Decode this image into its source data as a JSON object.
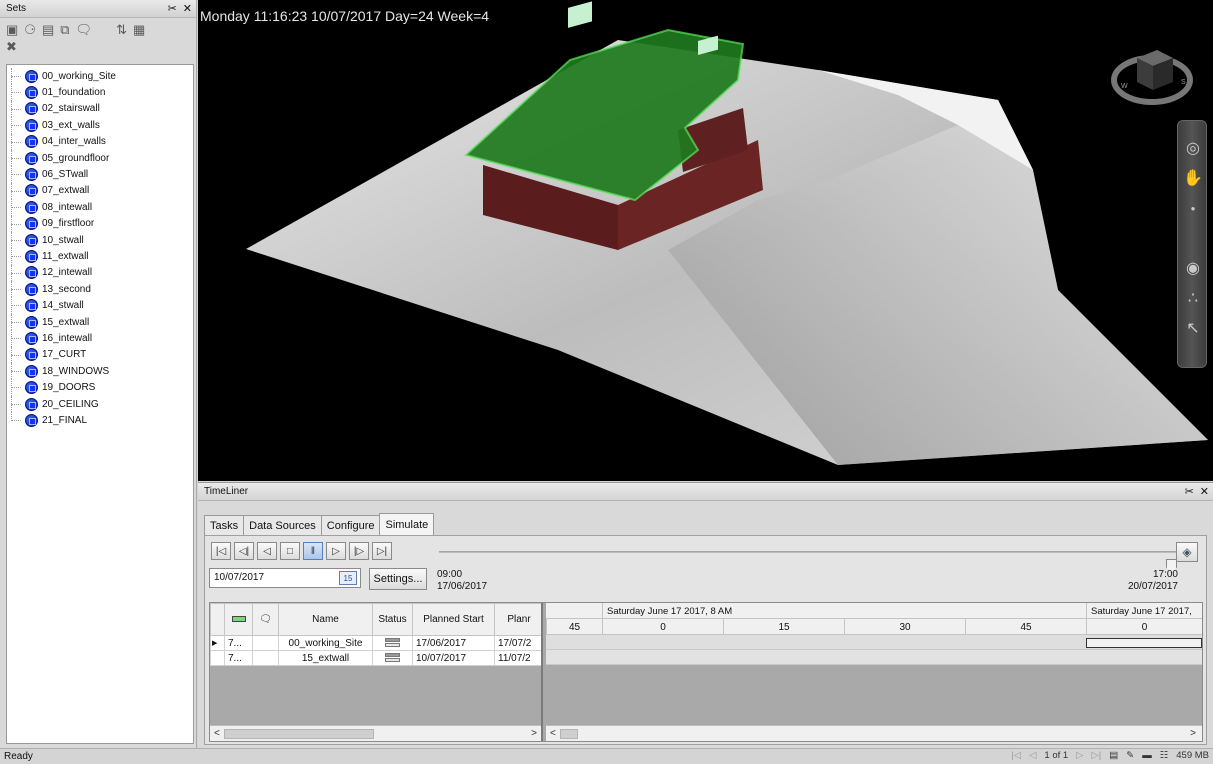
{
  "sets_panel": {
    "title": "Sets",
    "items": [
      "00_working_Site",
      "01_foundation",
      "02_stairswall",
      "03_ext_walls",
      "04_inter_walls",
      "05_groundfloor",
      "06_STwall",
      "07_extwall",
      "08_intewall",
      "09_firstfloor",
      "10_stwall",
      "11_extwall",
      "12_intewall",
      "13_second",
      "14_stwall",
      "15_extwall",
      "16_intewall",
      "17_CURT",
      "18_WINDOWS",
      "19_DOORS",
      "20_CEILING",
      "21_FINAL"
    ]
  },
  "viewport": {
    "info_text": "Monday 11:16:23 10/07/2017 Day=24 Week=4"
  },
  "timeliner": {
    "title": "TimeLiner",
    "tabs": [
      "Tasks",
      "Data Sources",
      "Configure",
      "Simulate"
    ],
    "active_tab": "Simulate",
    "date_value": "10/07/2017",
    "calendar_label": "15",
    "settings_label": "Settings...",
    "range_start_time": "09:00",
    "range_start_date": "17/06/2017",
    "range_end_time": "17:00",
    "range_end_date": "20/07/2017",
    "columns": [
      "Name",
      "Status",
      "Planned Start",
      "Planr"
    ],
    "rows": [
      {
        "id": "7...",
        "name": "00_working_Site",
        "planned_start": "17/06/2017",
        "planned_end": "17/07/2"
      },
      {
        "id": "7...",
        "name": "15_extwall",
        "planned_start": "10/07/2017",
        "planned_end": "11/07/2"
      }
    ],
    "gantt": {
      "header_day": "Saturday June 17 2017, 8 AM",
      "header_day2": "Saturday June 17 2017,",
      "minutes": [
        "45",
        "0",
        "15",
        "30",
        "45",
        "0"
      ]
    }
  },
  "statusbar": {
    "status": "Ready",
    "page": "1 of 1",
    "memory": "459 MB"
  },
  "colors": {
    "viewport_bg": "#000000",
    "panel_bg": "#d9d9d9",
    "set_icon": "#1530ff"
  }
}
